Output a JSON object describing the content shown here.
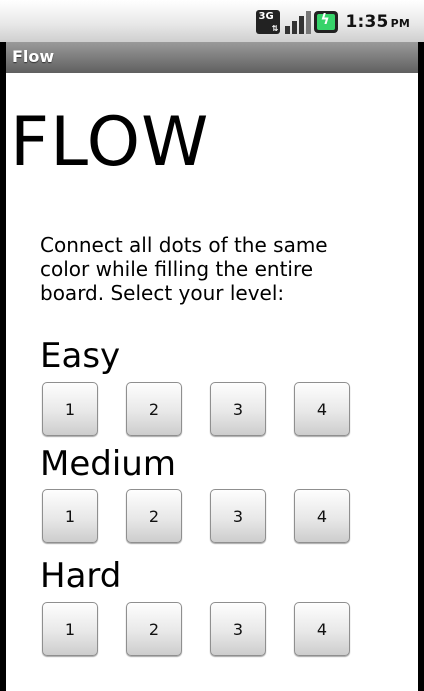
{
  "status_bar": {
    "network": "3G",
    "time": "1:35",
    "ampm": "PM",
    "icons": [
      "3g-icon",
      "signal-icon",
      "battery-charging-icon"
    ],
    "battery_color": "#36d36a"
  },
  "app": {
    "title": "Flow"
  },
  "main": {
    "heading": "FLOW",
    "instructions": "Connect all dots of the same color while filling the entire board. Select your level:",
    "sections": [
      {
        "label": "Easy",
        "buttons": [
          "1",
          "2",
          "3",
          "4"
        ]
      },
      {
        "label": "Medium",
        "buttons": [
          "1",
          "2",
          "3",
          "4"
        ]
      },
      {
        "label": "Hard",
        "buttons": [
          "1",
          "2",
          "3",
          "4"
        ]
      }
    ]
  }
}
